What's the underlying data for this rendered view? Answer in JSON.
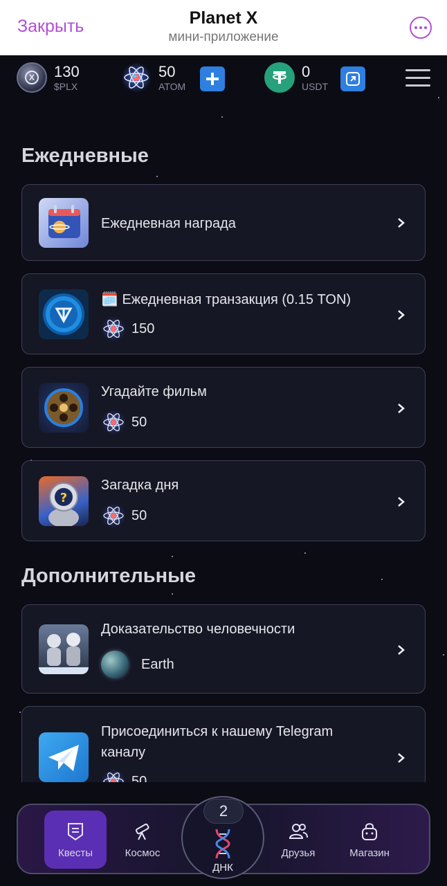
{
  "header": {
    "close_label": "Закрыть",
    "title": "Planet X",
    "subtitle": "мини-приложение",
    "more_icon": "more-circle-icon"
  },
  "balances": [
    {
      "value": "130",
      "name": "$PLX",
      "icon": "plx-coin-icon"
    },
    {
      "value": "50",
      "name": "ATOM",
      "icon": "atom-icon"
    },
    {
      "value": "0",
      "name": "USDT",
      "icon": "usdt-coin-icon"
    }
  ],
  "daily": {
    "title": "Ежедневные",
    "items": [
      {
        "title": "Ежедневная награда"
      },
      {
        "title": "🗓️ Ежедневная транзакция (0.15 TON)",
        "reward": "150"
      },
      {
        "title": "Угадайте фильм",
        "reward": "50"
      },
      {
        "title": "Загадка дня",
        "reward": "50"
      }
    ]
  },
  "extra": {
    "title": "Дополнительные",
    "items": [
      {
        "title": "Доказательство человечности",
        "tag": "Earth"
      },
      {
        "title": "Присоединиться к нашему Telegram каналу",
        "reward": "50"
      }
    ]
  },
  "nav": {
    "items": [
      {
        "label": "Квесты",
        "icon": "quests-icon",
        "active": true
      },
      {
        "label": "Космос",
        "icon": "telescope-icon",
        "active": false
      },
      {
        "label": "Друзья",
        "icon": "friends-icon",
        "active": false
      },
      {
        "label": "Магазин",
        "icon": "shop-bag-icon",
        "active": false
      }
    ],
    "dna": {
      "label": "ДНК",
      "badge": "2"
    }
  },
  "colors": {
    "accent": "#b24ed8",
    "background": "#0b0c14",
    "card": "#181926",
    "nav_active": "#5b2fb3"
  }
}
